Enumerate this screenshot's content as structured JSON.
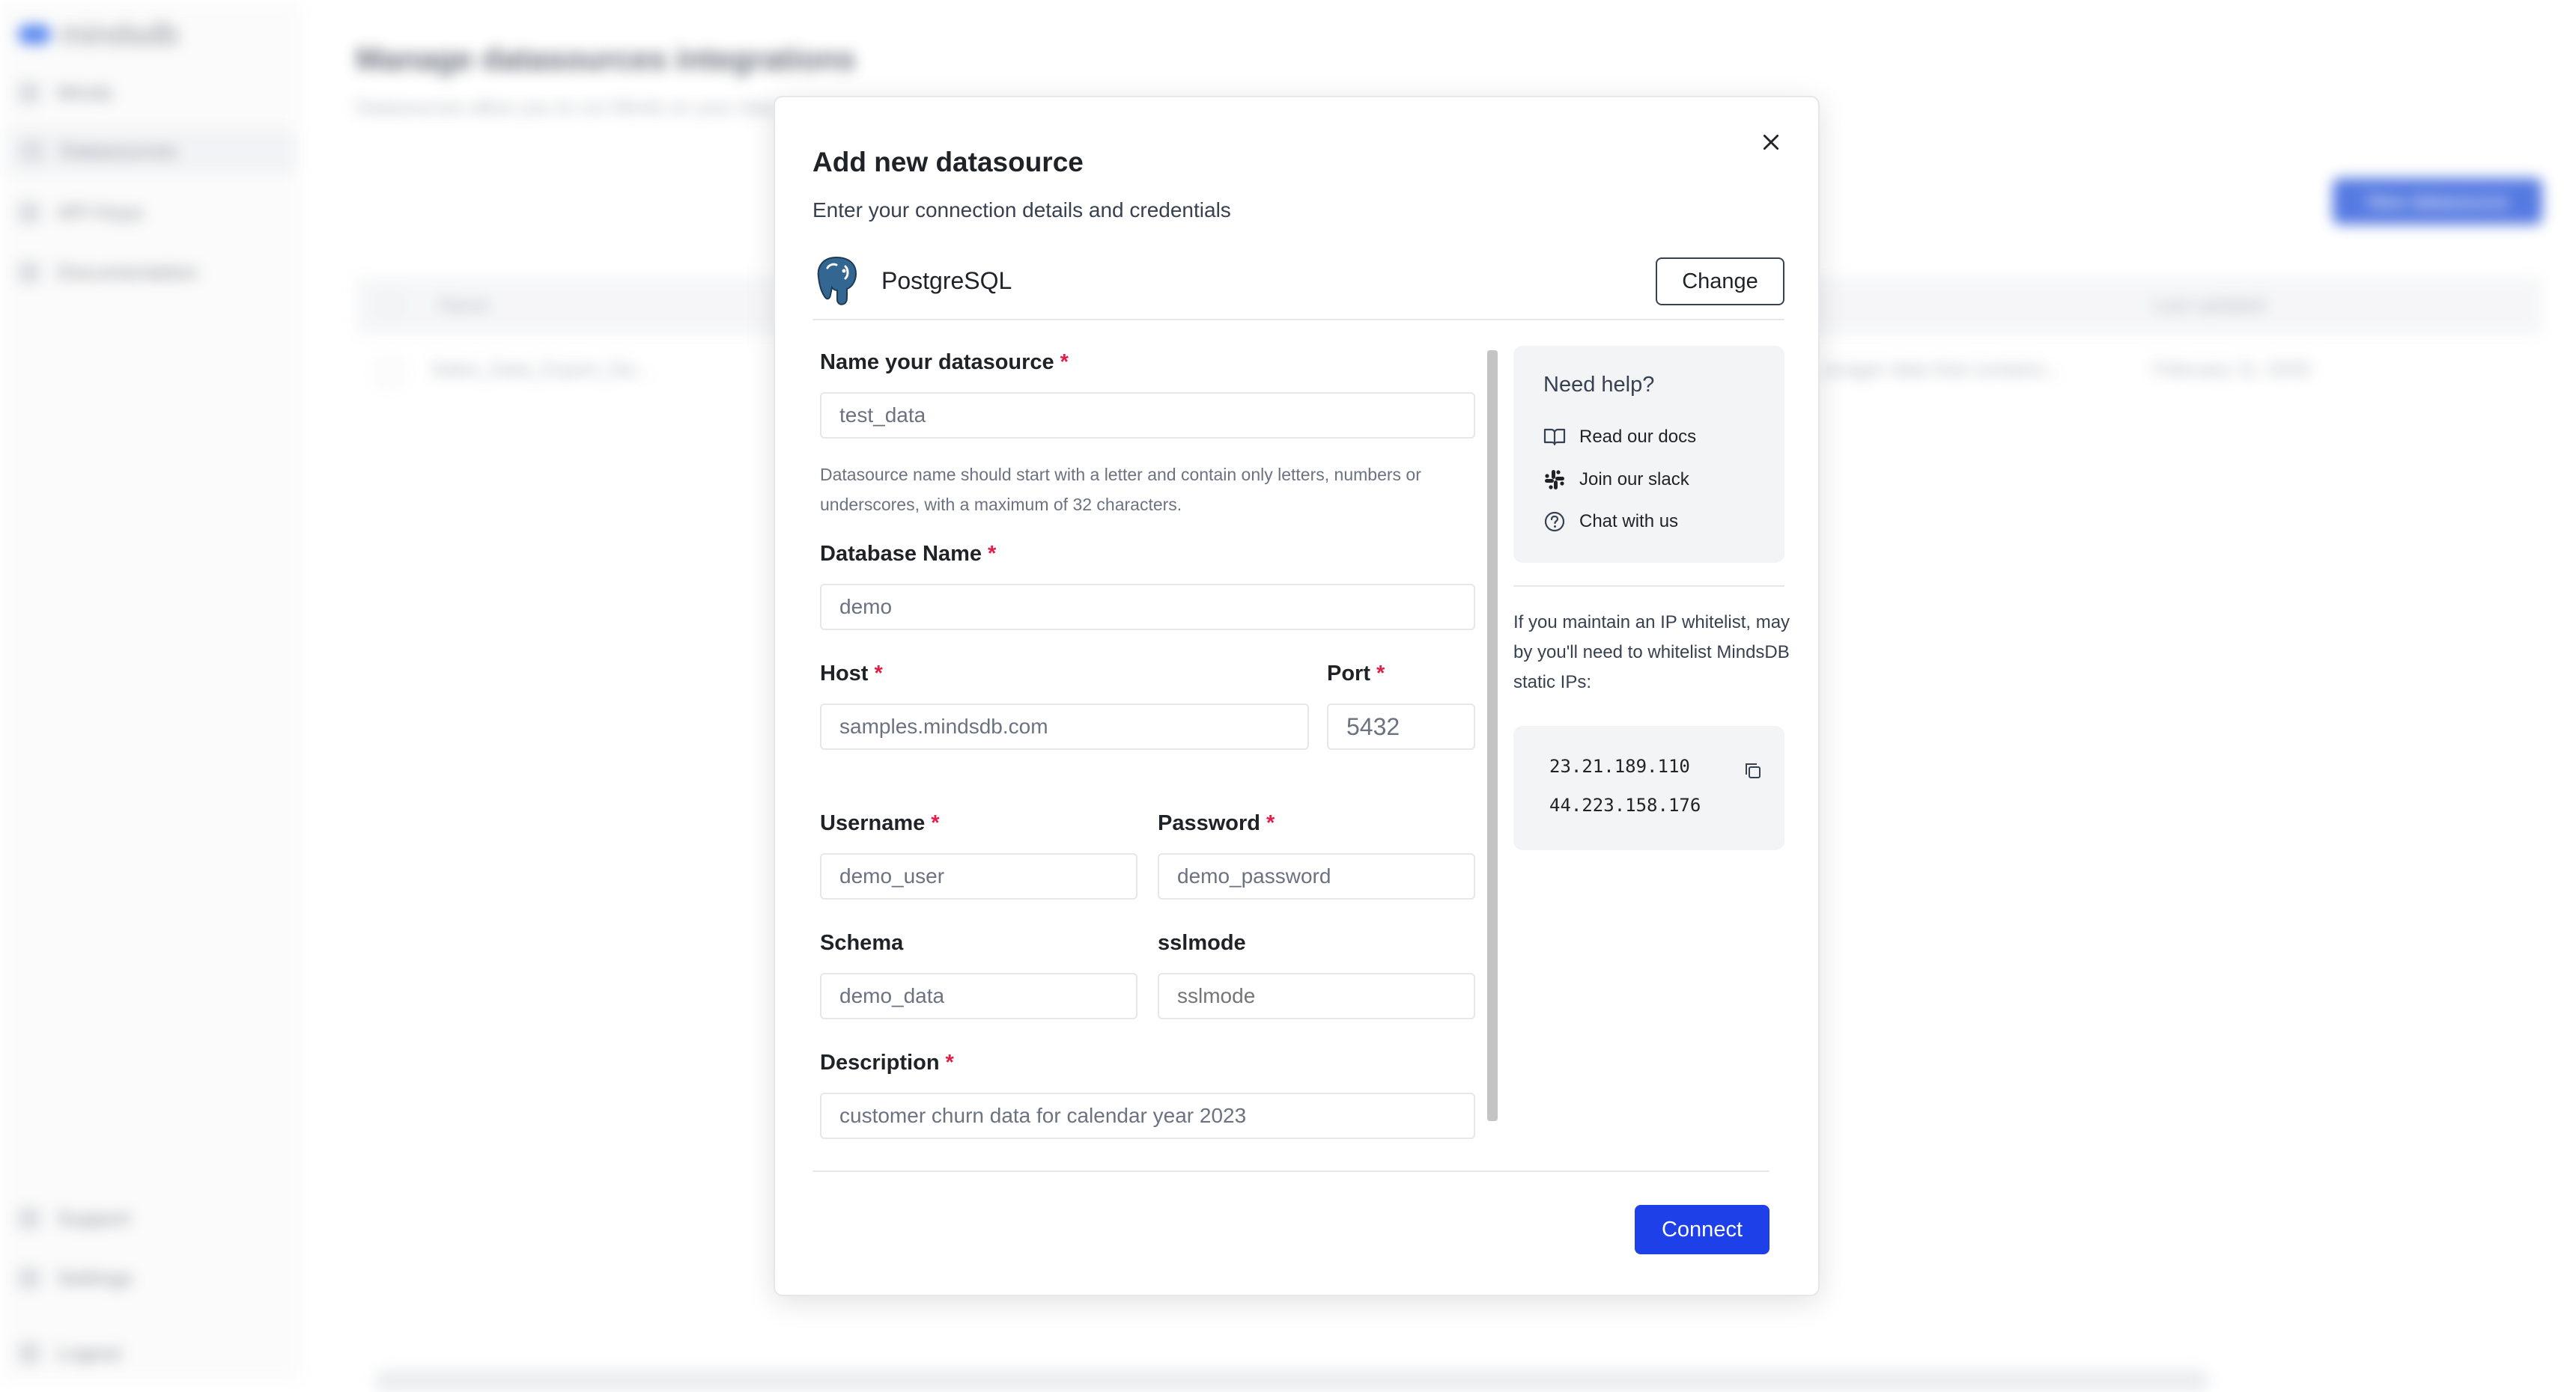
{
  "background": {
    "brand": "mindsdb",
    "sidebar_items": [
      "Minds",
      "Datasources",
      "API Keys",
      "Documentation"
    ],
    "sidebar_bottom": [
      "Support",
      "Settings",
      "Logout"
    ],
    "page_title": "Manage datasources integrations",
    "page_subtitle": "Datasources allow you to run Minds on your data",
    "new_button": "New datasource",
    "table_headers": {
      "name": "Name",
      "last_updated": "Last updated"
    },
    "row": {
      "name": "Sales_Data_Export_Da...",
      "description": "...anager data that contains...",
      "date": "February 11, 2025"
    }
  },
  "modal": {
    "title": "Add new datasource",
    "subtitle": "Enter your connection details and credentials",
    "provider": {
      "name": "PostgreSQL",
      "icon": "postgresql-elephant-icon"
    },
    "change_label": "Change",
    "fields": {
      "name": {
        "label": "Name your datasource",
        "required": "*",
        "value": "test_data"
      },
      "helper": "Datasource name should start with a letter and contain only letters, numbers or underscores, with a maximum of 32 characters.",
      "database": {
        "label": "Database Name",
        "required": "*",
        "value": "demo"
      },
      "host": {
        "label": "Host",
        "required": "*",
        "value": "samples.mindsdb.com"
      },
      "port": {
        "label": "Port",
        "required": "*",
        "value": "5432"
      },
      "username": {
        "label": "Username",
        "required": "*",
        "value": "demo_user"
      },
      "password": {
        "label": "Password",
        "required": "*",
        "value": "demo_password"
      },
      "schema": {
        "label": "Schema",
        "value": "demo_data"
      },
      "sslmode": {
        "label": "sslmode",
        "placeholder": "sslmode"
      },
      "description": {
        "label": "Description",
        "required": "*",
        "value": "customer churn data for calendar year 2023"
      }
    },
    "help": {
      "title": "Need help?",
      "links": [
        {
          "label": "Read our docs",
          "icon": "book-icon"
        },
        {
          "label": "Join our slack",
          "icon": "slack-icon"
        },
        {
          "label": "Chat with us",
          "icon": "question-circle-icon"
        }
      ],
      "ip_note": "If you maintain an IP whitelist, may by you'll need to whitelist MindsDB static IPs:",
      "ips": [
        "23.21.189.110",
        "44.223.158.176"
      ]
    },
    "connect_label": "Connect",
    "colors": {
      "primary": "#1e40e8",
      "required": "#e11d48"
    }
  }
}
